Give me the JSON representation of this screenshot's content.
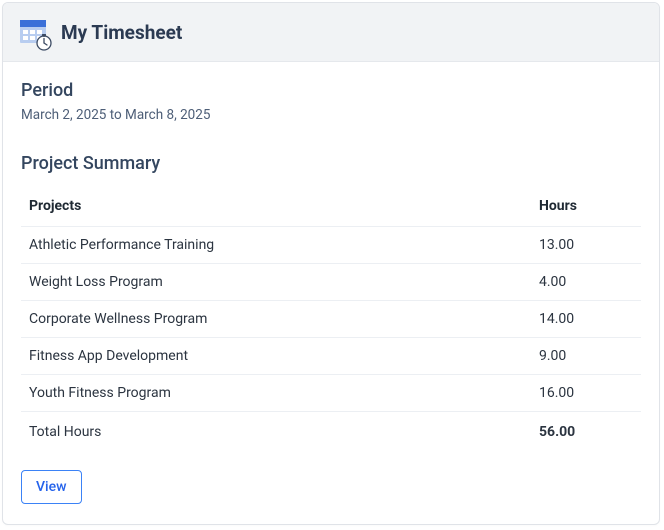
{
  "header": {
    "title": "My Timesheet"
  },
  "period": {
    "label": "Period",
    "text": "March 2, 2025 to March 8, 2025"
  },
  "summary": {
    "title": "Project Summary",
    "columns": {
      "project": "Projects",
      "hours": "Hours"
    },
    "rows": [
      {
        "project": "Athletic Performance Training",
        "hours": "13.00"
      },
      {
        "project": "Weight Loss Program",
        "hours": "4.00"
      },
      {
        "project": "Corporate Wellness Program",
        "hours": "14.00"
      },
      {
        "project": "Fitness App Development",
        "hours": "9.00"
      },
      {
        "project": "Youth Fitness Program",
        "hours": "16.00"
      }
    ],
    "total": {
      "label": "Total Hours",
      "value": "56.00"
    }
  },
  "actions": {
    "view": "View"
  }
}
